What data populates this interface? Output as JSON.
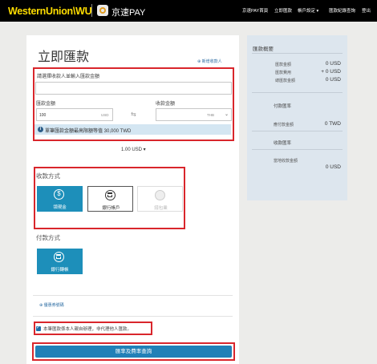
{
  "header": {
    "brand": "WesternUnion\\WU",
    "pay_name": "京速PAY",
    "nav": [
      "京速PAY首頁",
      "立即匯款",
      "帳戶設定 ▾",
      "匯款紀錄查詢",
      "登出"
    ]
  },
  "form": {
    "title": "立即匯款",
    "add_recipient": "⊕ 新增收款人",
    "recipient_label": "請選擇收款人並輸入匯款金額",
    "recipient_value": "",
    "send_label": "匯款金額",
    "send_value": "100",
    "send_currency": "USD",
    "receive_label": "收款金額",
    "receive_value": "",
    "receive_currency": "THB",
    "swap_icon": "⇆",
    "notice": "單筆匯款金額最高限額等值 30,000 TWD",
    "rate": "1.00 USD ▾",
    "receive_method_label": "收款方式",
    "receive_methods": [
      {
        "label": "領現金",
        "icon": "$",
        "state": "selected"
      },
      {
        "label": "銀行帳戶",
        "icon": "bank-icon",
        "state": "normal"
      },
      {
        "label": "錢包業",
        "icon": "wallet-icon",
        "state": "disabled"
      }
    ],
    "pay_method_label": "付款方式",
    "pay_methods": [
      {
        "label": "銀行轉帳",
        "icon": "bank-icon",
        "state": "selected"
      }
    ],
    "promo_link": "⊕ 優惠券號碼",
    "confirm_text": "本筆匯款係本人親自辦理，非代理他人匯款。",
    "confirm_checked": true,
    "submit": "匯率及費率查詢"
  },
  "summary": {
    "title": "匯款概要",
    "rows": [
      {
        "label": "匯款金額",
        "value": "0 USD"
      },
      {
        "label": "匯款費用",
        "value": "+ 0 USD"
      },
      {
        "label": "總匯款金額",
        "value": "0 USD"
      }
    ],
    "rate_title": "付款匯率",
    "rate_label": "應付款金額",
    "rate_value": "0 TWD",
    "receive_title": "收款匯率",
    "receive_label": "當地收款金額",
    "receive_value": "0 USD"
  },
  "colors": {
    "accent": "#2180b7",
    "highlight": "#d9262c",
    "brand": "#ffdd00"
  }
}
